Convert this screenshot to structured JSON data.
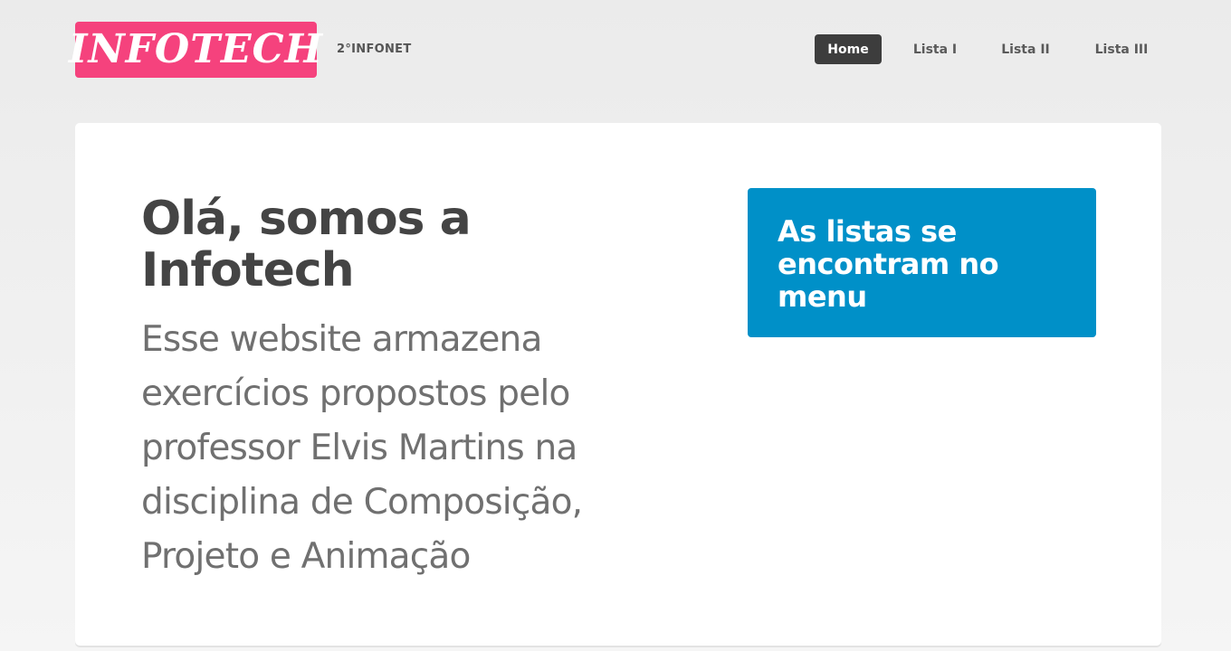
{
  "header": {
    "logo_text": "INFOTECH",
    "tagline": "2°INFONET",
    "nav": [
      {
        "label": "Home",
        "active": true
      },
      {
        "label": "Lista I",
        "active": false
      },
      {
        "label": "Lista II",
        "active": false
      },
      {
        "label": "Lista III",
        "active": false
      }
    ]
  },
  "main": {
    "headline": "Olá, somos a Infotech",
    "description": "Esse website armazena exercícios propostos pelo professor Elvis Martins na disciplina de Composição, Projeto e Animação",
    "callout": "As listas se encontram no menu"
  },
  "colors": {
    "brand": "#f5427d",
    "nav_active_bg": "#3d3d3d",
    "callout_bg": "#0090c8"
  }
}
